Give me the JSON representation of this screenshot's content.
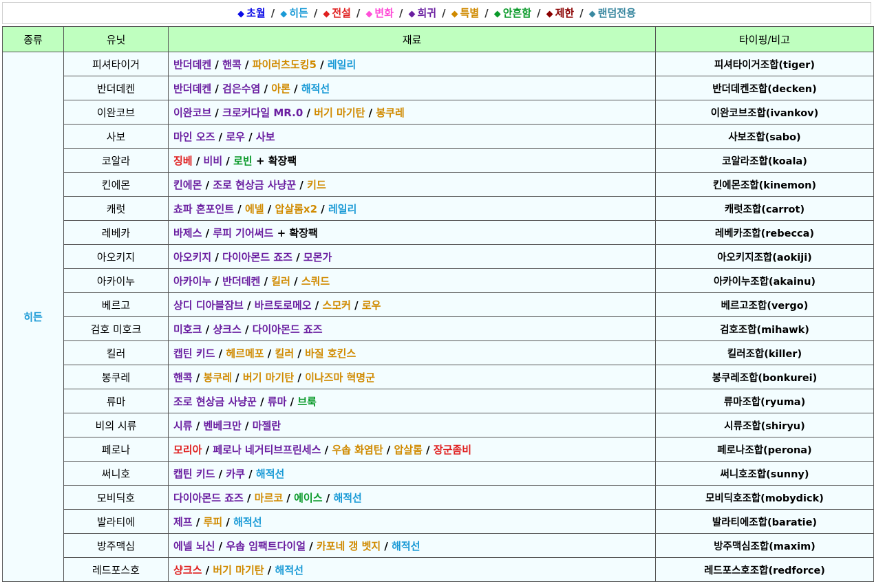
{
  "legend": [
    {
      "label": "초월",
      "color": "#0a0ae6"
    },
    {
      "label": "히든",
      "color": "#1a9ad6"
    },
    {
      "label": "전설",
      "color": "#e02020"
    },
    {
      "label": "변화",
      "color": "#ff4fd8"
    },
    {
      "label": "희귀",
      "color": "#6a1ea0"
    },
    {
      "label": "특별",
      "color": "#d08a00"
    },
    {
      "label": "안흔함",
      "color": "#0a9a2a"
    },
    {
      "label": "제한",
      "color": "#8a0000"
    },
    {
      "label": "랜덤전용",
      "color": "#3a88a0"
    }
  ],
  "legend_separator": "/",
  "headers": {
    "kind": "종류",
    "unit": "유닛",
    "material": "재료",
    "note": "타이핑/비고"
  },
  "kind_label": "히든",
  "colors": {
    "purple": "#6a1ea0",
    "orange": "#d08a00",
    "blue": "#1a9ad6",
    "red": "#e02020",
    "green": "#0a9a2a",
    "black": "#000000"
  },
  "rows": [
    {
      "unit": "피셔타이거",
      "note": "피셔타이거조합(tiger)",
      "materials": [
        {
          "t": "반더데켄",
          "c": "purple"
        },
        {
          "t": "핸콕",
          "c": "purple"
        },
        {
          "t": "파이러츠도킹5",
          "c": "orange"
        },
        {
          "t": "레일리",
          "c": "blue"
        }
      ]
    },
    {
      "unit": "반더데켄",
      "note": "반더데켄조합(decken)",
      "materials": [
        {
          "t": "반더데켄",
          "c": "purple"
        },
        {
          "t": "검은수염",
          "c": "purple"
        },
        {
          "t": "아론",
          "c": "orange"
        },
        {
          "t": "해적선",
          "c": "blue"
        }
      ]
    },
    {
      "unit": "이완코브",
      "note": "이완코브조합(ivankov)",
      "materials": [
        {
          "t": "이완코브",
          "c": "purple"
        },
        {
          "t": "크로커다일 MR.0",
          "c": "purple"
        },
        {
          "t": "버기 마기탄",
          "c": "orange"
        },
        {
          "t": "봉쿠레",
          "c": "orange"
        }
      ]
    },
    {
      "unit": "사보",
      "note": "사보조합(sabo)",
      "materials": [
        {
          "t": "마인 오즈",
          "c": "purple"
        },
        {
          "t": "로우",
          "c": "purple"
        },
        {
          "t": "사보",
          "c": "purple"
        }
      ]
    },
    {
      "unit": "코알라",
      "note": "코알라조합(koala)",
      "materials": [
        {
          "t": "징베",
          "c": "red"
        },
        {
          "t": "비비",
          "c": "purple"
        },
        {
          "t": "로빈",
          "c": "green"
        }
      ],
      "extra": "+ 확장팩"
    },
    {
      "unit": "킨에몬",
      "note": "킨에몬조합(kinemon)",
      "materials": [
        {
          "t": "킨에몬",
          "c": "purple"
        },
        {
          "t": "조로 현상금 사냥꾼",
          "c": "purple"
        },
        {
          "t": "키드",
          "c": "orange"
        }
      ]
    },
    {
      "unit": "캐럿",
      "note": "캐럿조합(carrot)",
      "materials": [
        {
          "t": "쵸파 혼포인트",
          "c": "purple"
        },
        {
          "t": "에넬",
          "c": "orange"
        },
        {
          "t": "압살롬x2",
          "c": "orange"
        },
        {
          "t": "레일리",
          "c": "blue"
        }
      ]
    },
    {
      "unit": "레베카",
      "note": "레베카조합(rebecca)",
      "materials": [
        {
          "t": "바제스",
          "c": "purple"
        },
        {
          "t": "루피 기어써드",
          "c": "purple"
        }
      ],
      "extra": "+ 확장팩"
    },
    {
      "unit": "아오키지",
      "note": "아오키지조합(aokiji)",
      "materials": [
        {
          "t": "아오키지",
          "c": "purple"
        },
        {
          "t": "다이아몬드 죠즈",
          "c": "purple"
        },
        {
          "t": "모몬가",
          "c": "purple"
        }
      ]
    },
    {
      "unit": "아카이누",
      "note": "아카이누조합(akainu)",
      "materials": [
        {
          "t": "아카이누",
          "c": "purple"
        },
        {
          "t": "반더데켄",
          "c": "purple"
        },
        {
          "t": "킬러",
          "c": "orange"
        },
        {
          "t": "스쿼드",
          "c": "orange"
        }
      ]
    },
    {
      "unit": "베르고",
      "note": "베르고조합(vergo)",
      "materials": [
        {
          "t": "상디 디아블잠브",
          "c": "purple"
        },
        {
          "t": "바르토로메오",
          "c": "purple"
        },
        {
          "t": "스모커",
          "c": "orange"
        },
        {
          "t": "로우",
          "c": "orange"
        }
      ]
    },
    {
      "unit": "검호 미호크",
      "note": "검호조합(mihawk)",
      "materials": [
        {
          "t": "미호크",
          "c": "purple"
        },
        {
          "t": "샹크스",
          "c": "purple"
        },
        {
          "t": "다이아몬드 죠즈",
          "c": "purple"
        }
      ]
    },
    {
      "unit": "킬러",
      "note": "킬러조합(killer)",
      "materials": [
        {
          "t": "캡틴 키드",
          "c": "purple"
        },
        {
          "t": "헤르메포",
          "c": "orange"
        },
        {
          "t": "킬러",
          "c": "orange"
        },
        {
          "t": "바질 호킨스",
          "c": "orange"
        }
      ]
    },
    {
      "unit": "봉쿠레",
      "note": "봉쿠레조합(bonkurei)",
      "materials": [
        {
          "t": "핸콕",
          "c": "purple"
        },
        {
          "t": "봉쿠레",
          "c": "orange"
        },
        {
          "t": "버기 마기탄",
          "c": "orange"
        },
        {
          "t": "이나즈마 혁명군",
          "c": "orange"
        }
      ]
    },
    {
      "unit": "류마",
      "note": "류마조합(ryuma)",
      "materials": [
        {
          "t": "조로 현상금 사냥꾼",
          "c": "purple"
        },
        {
          "t": "류마",
          "c": "purple"
        },
        {
          "t": "브룩",
          "c": "green"
        }
      ]
    },
    {
      "unit": "비의 시류",
      "note": "시류조합(shiryu)",
      "materials": [
        {
          "t": "시류",
          "c": "purple"
        },
        {
          "t": "벤베크만",
          "c": "purple"
        },
        {
          "t": "마젤란",
          "c": "purple"
        }
      ]
    },
    {
      "unit": "페로나",
      "note": "페로나조합(perona)",
      "materials": [
        {
          "t": "모리아",
          "c": "red"
        },
        {
          "t": "페로나 네거티브프린세스",
          "c": "purple"
        },
        {
          "t": "우솝 화염탄",
          "c": "orange"
        },
        {
          "t": "압살롬",
          "c": "orange"
        },
        {
          "t": "장군좀비",
          "c": "red"
        }
      ]
    },
    {
      "unit": "써니호",
      "note": "써니호조합(sunny)",
      "materials": [
        {
          "t": "캡틴 키드",
          "c": "purple"
        },
        {
          "t": "카쿠",
          "c": "purple"
        },
        {
          "t": "해적선",
          "c": "blue"
        }
      ]
    },
    {
      "unit": "모비딕호",
      "note": "모비딕호조합(mobydick)",
      "materials": [
        {
          "t": "다이아몬드 죠즈",
          "c": "purple"
        },
        {
          "t": "마르코",
          "c": "orange"
        },
        {
          "t": "에이스",
          "c": "green"
        },
        {
          "t": "해적선",
          "c": "blue"
        }
      ]
    },
    {
      "unit": "발라티에",
      "note": "발라티에조합(baratie)",
      "materials": [
        {
          "t": "제프",
          "c": "purple"
        },
        {
          "t": "루피",
          "c": "orange"
        },
        {
          "t": "해적선",
          "c": "blue"
        }
      ]
    },
    {
      "unit": "방주맥심",
      "note": "방주맥심조합(maxim)",
      "materials": [
        {
          "t": "에넬 뇌신",
          "c": "purple"
        },
        {
          "t": "우솝 임팩트다이얼",
          "c": "purple"
        },
        {
          "t": "카포네 갱 벳지",
          "c": "orange"
        },
        {
          "t": "해적선",
          "c": "blue"
        }
      ]
    },
    {
      "unit": "레드포스호",
      "note": "레드포스호조합(redforce)",
      "materials": [
        {
          "t": "샹크스",
          "c": "red"
        },
        {
          "t": "버기 마기탄",
          "c": "orange"
        },
        {
          "t": "해적선",
          "c": "blue"
        }
      ]
    }
  ]
}
